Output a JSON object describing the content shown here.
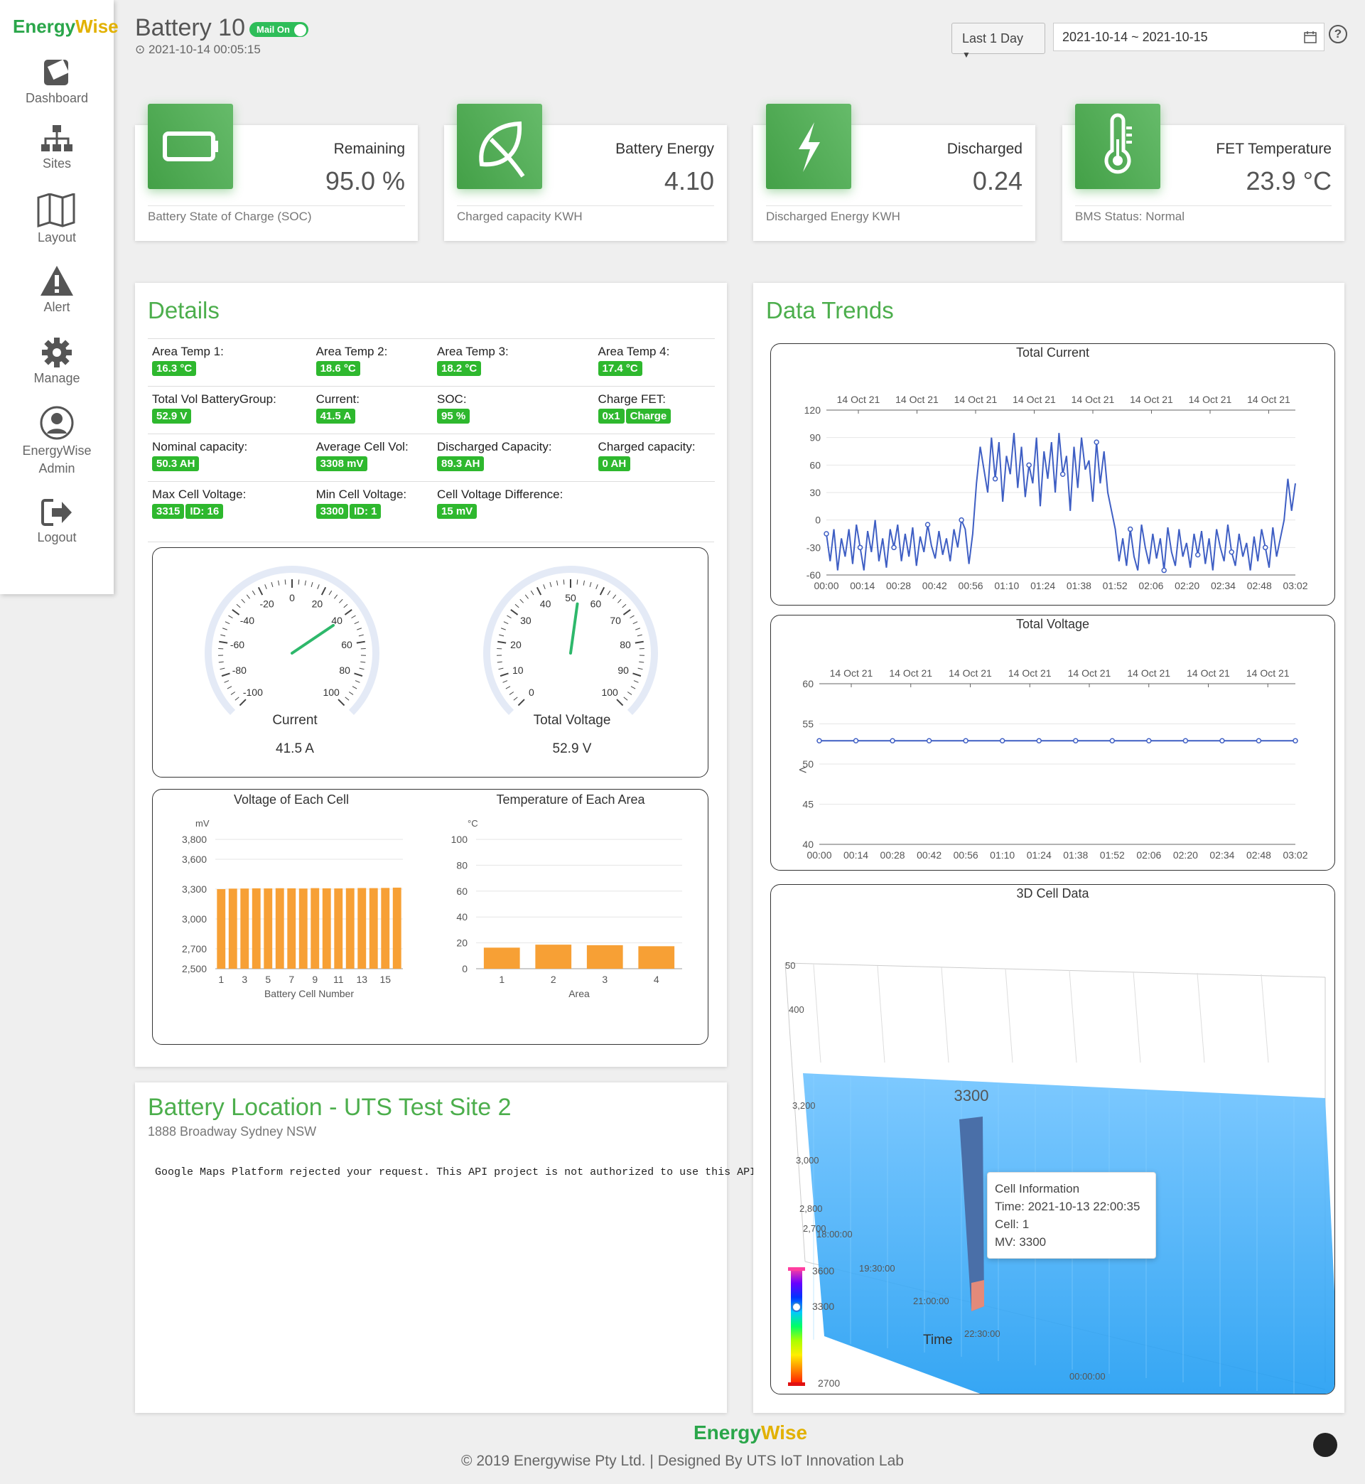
{
  "app": {
    "logo_a": "Energy",
    "logo_w": "W",
    "logo_b": "ise"
  },
  "sidebar": {
    "items": [
      {
        "label": "Dashboard",
        "icon": "dashboard-icon"
      },
      {
        "label": "Sites",
        "icon": "sites-icon"
      },
      {
        "label": "Layout",
        "icon": "map-icon"
      },
      {
        "label": "Alert",
        "icon": "alert-icon"
      },
      {
        "label": "Manage",
        "icon": "gear-icon"
      },
      {
        "label": "EnergyWise",
        "label2": "Admin",
        "icon": "user-icon"
      },
      {
        "label": "Logout",
        "icon": "logout-icon"
      }
    ]
  },
  "header": {
    "title": "Battery 10",
    "mail_toggle": "Mail On",
    "timestamp": "2021-10-14 00:05:15",
    "range_button": "Last 1 Day",
    "date_range": "2021-10-14 ~ 2021-10-15"
  },
  "kpis": [
    {
      "label": "Remaining",
      "value": "95.0 %",
      "footer": "Battery State of Charge (SOC)",
      "icon": "battery-icon"
    },
    {
      "label": "Battery Energy",
      "value": "4.10",
      "footer": "Charged capacity KWH",
      "icon": "leaf-icon"
    },
    {
      "label": "Discharged",
      "value": "0.24",
      "footer": "Discharged Energy KWH",
      "icon": "bolt-icon"
    },
    {
      "label": "FET Temperature",
      "value": "23.9 °C",
      "footer": "BMS Status: Normal",
      "icon": "thermometer-icon"
    }
  ],
  "details": {
    "title": "Details",
    "rows": [
      [
        {
          "label": "Area Temp 1:",
          "badges": [
            "16.3 °C"
          ]
        },
        {
          "label": "Area Temp 2:",
          "badges": [
            "18.6 °C"
          ]
        },
        {
          "label": "Area Temp 3:",
          "badges": [
            "18.2 °C"
          ]
        },
        {
          "label": "Area Temp 4:",
          "badges": [
            "17.4 °C"
          ]
        }
      ],
      [
        {
          "label": "Total Vol BatteryGroup:",
          "badges": [
            "52.9 V"
          ]
        },
        {
          "label": "Current:",
          "badges": [
            "41.5 A"
          ]
        },
        {
          "label": "SOC:",
          "badges": [
            "95 %"
          ]
        },
        {
          "label": "Charge FET:",
          "badges": [
            "0x1",
            "Charge"
          ]
        }
      ],
      [
        {
          "label": "Nominal capacity:",
          "badges": [
            "50.3 AH"
          ]
        },
        {
          "label": "Average Cell Vol:",
          "badges": [
            "3308 mV"
          ]
        },
        {
          "label": "Discharged Capacity:",
          "badges": [
            "89.3 AH"
          ]
        },
        {
          "label": "Charged capacity:",
          "badges": [
            "0 AH"
          ]
        }
      ],
      [
        {
          "label": "Max Cell Voltage:",
          "badges": [
            "3315",
            "ID: 16"
          ]
        },
        {
          "label": "Min Cell Voltage:",
          "badges": [
            "3300",
            "ID: 1"
          ]
        },
        {
          "label": "Cell Voltage Difference:",
          "badges": [
            "15 mV"
          ]
        },
        {
          "label": "",
          "badges": []
        }
      ]
    ]
  },
  "gauges": [
    {
      "name": "Current",
      "value": 41.5,
      "display": "41.5 A",
      "min": -100,
      "max": 100,
      "ticks": [
        "-100",
        "-80",
        "-60",
        "-40",
        "-20",
        "0",
        "20",
        "40",
        "60",
        "80",
        "100"
      ]
    },
    {
      "name": "Total Voltage",
      "value": 52.9,
      "display": "52.9 V",
      "min": 0,
      "max": 100,
      "ticks": [
        "0",
        "10",
        "20",
        "30",
        "40",
        "50",
        "60",
        "70",
        "80",
        "90",
        "100"
      ]
    }
  ],
  "trends": {
    "title": "Data Trends"
  },
  "location": {
    "title": "Battery Location - UTS Test Site 2",
    "address": "1888 Broadway Sydney NSW",
    "map_message": "Google Maps Platform rejected your request. This API project is not authorized to use this API."
  },
  "cell3d": {
    "title": "3D Cell Data",
    "highlight_value": "3300",
    "axis_labels": [
      "50",
      "400",
      "3,200",
      "3,000",
      "2,800",
      "2,700"
    ],
    "time_ticks": [
      "18:00:00",
      "19:30:00",
      "21:00:00",
      "22:30:00",
      "00:00:00"
    ],
    "time_label": "Time",
    "legend": [
      "3600",
      "3300",
      "2700"
    ],
    "tooltip": {
      "title": "Cell Information",
      "time": "Time: 2021-10-13 22:00:35",
      "cell": "Cell: 1",
      "mv": "MV: 3300"
    }
  },
  "footer": {
    "logo_a": "Energy",
    "logo_w": "W",
    "logo_b": "ise",
    "text": "© 2019 Energywise Pty Ltd. | Designed By UTS IoT Innovation Lab"
  },
  "chart_data": [
    {
      "type": "line",
      "title": "Total Current",
      "x_top": [
        "14 Oct 21",
        "14 Oct 21",
        "14 Oct 21",
        "14 Oct 21",
        "14 Oct 21",
        "14 Oct 21",
        "14 Oct 21",
        "14 Oct 21"
      ],
      "x": [
        "00:00",
        "00:14",
        "00:28",
        "00:42",
        "00:56",
        "01:10",
        "01:24",
        "01:38",
        "01:52",
        "02:06",
        "02:20",
        "02:34",
        "02:48",
        "03:02"
      ],
      "ylim": [
        -60,
        120
      ],
      "yticks": [
        "-60",
        "-30",
        "0",
        "30",
        "60",
        "90",
        "120"
      ],
      "series": [
        {
          "values": [
            -15,
            -45,
            -10,
            -55,
            -20,
            -40,
            -10,
            -48,
            -5,
            -30,
            -55,
            -12,
            -35,
            0,
            -45,
            -20,
            -52,
            -10,
            -30,
            -5,
            -45,
            -15,
            -40,
            -8,
            -50,
            -18,
            -35,
            -5,
            -28,
            -42,
            -12,
            -38,
            -20,
            -45,
            -10,
            -30,
            0,
            -10,
            -48,
            -15,
            40,
            80,
            55,
            30,
            90,
            45,
            85,
            20,
            70,
            50,
            95,
            35,
            80,
            25,
            60,
            40,
            90,
            15,
            75,
            45,
            85,
            30,
            95,
            50,
            70,
            10,
            80,
            35,
            90,
            55,
            65,
            20,
            85,
            40,
            75,
            30,
            10,
            -10,
            -45,
            -20,
            -50,
            -10,
            -40,
            -55,
            -5,
            -30,
            -48,
            -15,
            -42,
            -20,
            -55,
            -8,
            -35,
            -50,
            -10,
            -40,
            -25,
            -52,
            -15,
            -38,
            -12,
            -48,
            -20,
            -55,
            -10,
            -30,
            -45,
            -5,
            -35,
            -50,
            -15,
            -40,
            -25,
            -55,
            -18,
            -45,
            -10,
            -30,
            -52,
            -8,
            -40,
            -20,
            0,
            45,
            10,
            40
          ]
        }
      ]
    },
    {
      "type": "line",
      "title": "Total Voltage",
      "x_top": [
        "14 Oct 21",
        "14 Oct 21",
        "14 Oct 21",
        "14 Oct 21",
        "14 Oct 21",
        "14 Oct 21",
        "14 Oct 21",
        "14 Oct 21"
      ],
      "x": [
        "00:00",
        "00:14",
        "00:28",
        "00:42",
        "00:56",
        "01:10",
        "01:24",
        "01:38",
        "01:52",
        "02:06",
        "02:20",
        "02:34",
        "02:48",
        "03:02"
      ],
      "ylabel": "V",
      "ylim": [
        40,
        60
      ],
      "yticks": [
        "40",
        "45",
        "50",
        "55",
        "60"
      ],
      "series": [
        {
          "values": [
            52.9,
            52.9,
            52.9,
            52.9,
            52.9,
            52.9,
            52.9,
            52.9,
            52.9,
            52.9,
            52.9,
            52.9,
            52.9,
            52.9
          ]
        }
      ]
    },
    {
      "type": "bar",
      "title": "Voltage of Each Cell",
      "xlabel": "Battery Cell Number",
      "ylabel": "mV",
      "categories": [
        "1",
        "2",
        "3",
        "4",
        "5",
        "6",
        "7",
        "8",
        "9",
        "10",
        "11",
        "12",
        "13",
        "14",
        "15",
        "16"
      ],
      "xticks": [
        "1",
        "3",
        "5",
        "7",
        "9",
        "11",
        "13",
        "15"
      ],
      "yticks": [
        "2,500",
        "2,700",
        "3,000",
        "3,300",
        "3,600",
        "3,800"
      ],
      "ylim": [
        2500,
        3800
      ],
      "values": [
        3300,
        3305,
        3306,
        3308,
        3307,
        3309,
        3308,
        3306,
        3310,
        3308,
        3307,
        3309,
        3311,
        3310,
        3312,
        3315
      ],
      "color": "#f7a035"
    },
    {
      "type": "bar",
      "title": "Temperature of Each Area",
      "xlabel": "Area",
      "ylabel": "°C",
      "categories": [
        "1",
        "2",
        "3",
        "4"
      ],
      "yticks": [
        "0",
        "20",
        "40",
        "60",
        "80",
        "100"
      ],
      "ylim": [
        0,
        100
      ],
      "values": [
        16.3,
        18.6,
        18.2,
        17.4
      ],
      "color": "#f7a035"
    }
  ]
}
